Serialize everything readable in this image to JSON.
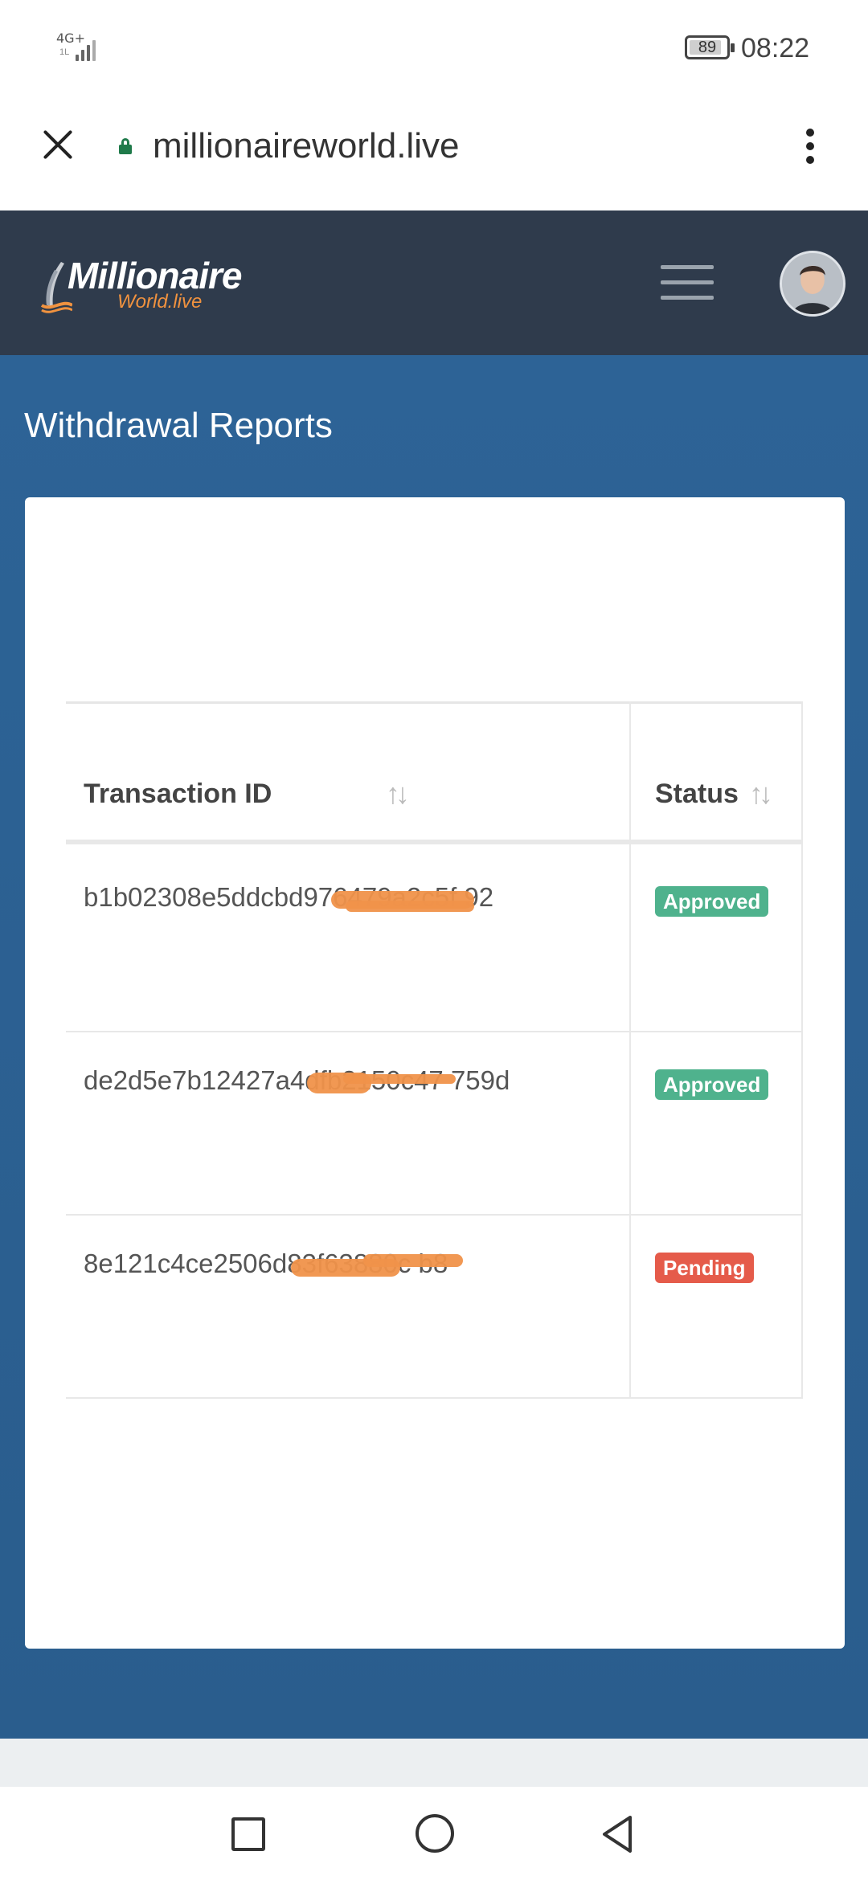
{
  "status_bar": {
    "network": "4G+",
    "network_sub": "1L",
    "battery": "89",
    "time": "08:22"
  },
  "browser": {
    "url": "millionaireworld.live"
  },
  "header": {
    "logo_line1": "Millionaire",
    "logo_line2": "World.live"
  },
  "page": {
    "title": "Withdrawal Reports"
  },
  "table": {
    "columns": [
      "Transaction ID",
      "Status"
    ],
    "rows": [
      {
        "transaction_id": "b1b02308e5ddcbd976479a2c5f   92",
        "status": "Approved"
      },
      {
        "transaction_id": "de2d5e7b12427a4dfb2150c47    759d",
        "status": "Approved"
      },
      {
        "transaction_id": "8e121c4ce2506d83f63880c      b8",
        "status": "Pending"
      }
    ]
  },
  "colors": {
    "header_bg": "#2f3b4c",
    "page_bg": "#2d6396",
    "approved": "#4fb28d",
    "pending": "#e55b4a",
    "brand_orange": "#f0923f"
  }
}
